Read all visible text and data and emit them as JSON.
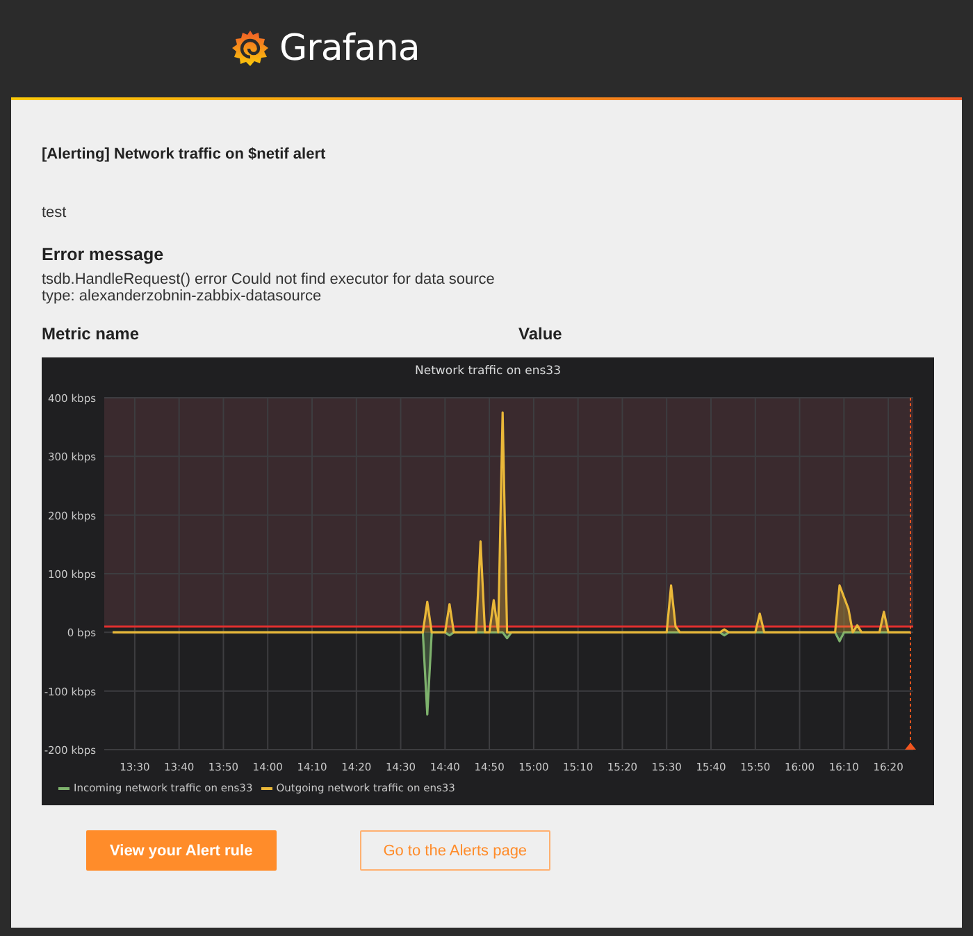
{
  "header": {
    "logo_text": "Grafana"
  },
  "alert": {
    "title": "[Alerting] Network traffic on $netif alert",
    "message": "test",
    "error_heading": "Error message",
    "error_text": "tsdb.HandleRequest() error Could not find executor for data source type: alexanderzobnin-zabbix-datasource"
  },
  "metrics_table": {
    "columns": [
      "Metric name",
      "Value"
    ]
  },
  "panel": {
    "chart_data": {
      "type": "area",
      "title": "Network traffic on ens33",
      "categories": [
        null,
        null,
        null,
        null,
        null,
        "13:30",
        null,
        null,
        null,
        null,
        null,
        null,
        null,
        null,
        null,
        "13:40",
        null,
        null,
        null,
        null,
        null,
        null,
        null,
        null,
        null,
        "13:50",
        null,
        null,
        null,
        null,
        null,
        null,
        null,
        null,
        null,
        "14:00",
        null,
        null,
        null,
        null,
        null,
        null,
        null,
        null,
        null,
        "14:10",
        null,
        null,
        null,
        null,
        null,
        null,
        null,
        null,
        null,
        "14:20",
        null,
        null,
        null,
        null,
        null,
        null,
        null,
        null,
        null,
        "14:30",
        null,
        null,
        null,
        null,
        null,
        null,
        null,
        null,
        null,
        "14:40",
        null,
        null,
        null,
        null,
        null,
        null,
        null,
        null,
        null,
        "14:50",
        null,
        null,
        null,
        null,
        null,
        null,
        null,
        null,
        null,
        "15:00",
        null,
        null,
        null,
        null,
        null,
        null,
        null,
        null,
        null,
        "15:10",
        null,
        null,
        null,
        null,
        null,
        null,
        null,
        null,
        null,
        "15:20",
        null,
        null,
        null,
        null,
        null,
        null,
        null,
        null,
        null,
        "15:30",
        null,
        null,
        null,
        null,
        null,
        null,
        null,
        null,
        null,
        "15:40",
        null,
        null,
        null,
        null,
        null,
        null,
        null,
        null,
        null,
        "15:50",
        null,
        null,
        null,
        null,
        null,
        null,
        null,
        null,
        null,
        "16:00",
        null,
        null,
        null,
        null,
        null,
        null,
        null,
        null,
        null,
        "16:10",
        null,
        null,
        null,
        null,
        null,
        null,
        null,
        null,
        null,
        "16:20",
        null,
        null,
        null,
        null,
        null
      ],
      "series": [
        {
          "name": "Incoming network traffic on ens33",
          "color": "#7eb26d",
          "values": [
            0,
            0,
            0,
            0,
            0,
            0,
            0,
            0,
            0,
            0,
            0,
            0,
            0,
            0,
            0,
            0,
            0,
            0,
            0,
            0,
            0,
            0,
            0,
            0,
            0,
            0,
            0,
            0,
            0,
            0,
            0,
            0,
            0,
            0,
            0,
            0,
            0,
            0,
            0,
            0,
            0,
            0,
            0,
            0,
            0,
            0,
            0,
            0,
            0,
            0,
            0,
            0,
            0,
            0,
            0,
            0,
            0,
            0,
            0,
            0,
            0,
            0,
            0,
            0,
            0,
            0,
            0,
            0,
            0,
            0,
            0,
            -140,
            0,
            0,
            0,
            0,
            -5,
            0,
            0,
            0,
            0,
            0,
            0,
            0,
            0,
            0,
            0,
            0,
            0,
            -10,
            0,
            0,
            0,
            0,
            0,
            0,
            0,
            0,
            0,
            0,
            0,
            0,
            0,
            0,
            0,
            0,
            0,
            0,
            0,
            0,
            0,
            0,
            0,
            0,
            0,
            0,
            0,
            0,
            0,
            0,
            0,
            0,
            0,
            0,
            0,
            0,
            0,
            0,
            0,
            0,
            0,
            0,
            0,
            0,
            0,
            0,
            0,
            0,
            -5,
            0,
            0,
            0,
            0,
            0,
            0,
            0,
            0,
            0,
            0,
            0,
            0,
            0,
            0,
            0,
            0,
            0,
            0,
            0,
            0,
            0,
            0,
            0,
            0,
            0,
            -15,
            0,
            0,
            0,
            0,
            0,
            0,
            0,
            0,
            0,
            0,
            0,
            0,
            0,
            0,
            0,
            0
          ]
        },
        {
          "name": "Outgoing network traffic on ens33",
          "color": "#eab839",
          "values": [
            0,
            0,
            0,
            0,
            0,
            0,
            0,
            0,
            0,
            0,
            0,
            0,
            0,
            0,
            0,
            0,
            0,
            0,
            0,
            0,
            0,
            0,
            0,
            0,
            0,
            0,
            0,
            0,
            0,
            0,
            0,
            0,
            0,
            0,
            0,
            0,
            0,
            0,
            0,
            0,
            0,
            0,
            0,
            0,
            0,
            0,
            0,
            0,
            0,
            0,
            0,
            0,
            0,
            0,
            0,
            0,
            0,
            0,
            0,
            0,
            0,
            0,
            0,
            0,
            0,
            0,
            0,
            0,
            0,
            0,
            0,
            52,
            0,
            0,
            0,
            0,
            48,
            0,
            0,
            0,
            0,
            0,
            0,
            155,
            0,
            0,
            55,
            0,
            375,
            0,
            0,
            0,
            0,
            0,
            0,
            0,
            0,
            0,
            0,
            0,
            0,
            0,
            0,
            0,
            0,
            0,
            0,
            0,
            0,
            0,
            0,
            0,
            0,
            0,
            0,
            0,
            0,
            0,
            0,
            0,
            0,
            0,
            0,
            0,
            0,
            0,
            80,
            10,
            0,
            0,
            0,
            0,
            0,
            0,
            0,
            0,
            0,
            0,
            5,
            0,
            0,
            0,
            0,
            0,
            0,
            0,
            32,
            0,
            0,
            0,
            0,
            0,
            0,
            0,
            0,
            0,
            0,
            0,
            0,
            0,
            0,
            0,
            0,
            0,
            80,
            60,
            40,
            0,
            12,
            0,
            0,
            0,
            0,
            0,
            35,
            0,
            0,
            0,
            0,
            0,
            0
          ]
        }
      ],
      "ylim": [
        -200,
        400
      ],
      "yticks": [
        {
          "value": 400,
          "label": "400 kbps"
        },
        {
          "value": 300,
          "label": "300 kbps"
        },
        {
          "value": 200,
          "label": "200 kbps"
        },
        {
          "value": 100,
          "label": "100 kbps"
        },
        {
          "value": 0,
          "label": "0 bps"
        },
        {
          "value": -100,
          "label": "-100 kbps"
        },
        {
          "value": -200,
          "label": "-200 kbps"
        }
      ],
      "ref_lines": [
        {
          "axis": "y",
          "value": 10,
          "color": "#e02f2f"
        }
      ],
      "grid": true,
      "legend": "bottom"
    }
  },
  "buttons": [
    {
      "label": "View your Alert rule",
      "kind": "primary"
    },
    {
      "label": "Go to the Alerts page",
      "kind": "secondary"
    }
  ]
}
